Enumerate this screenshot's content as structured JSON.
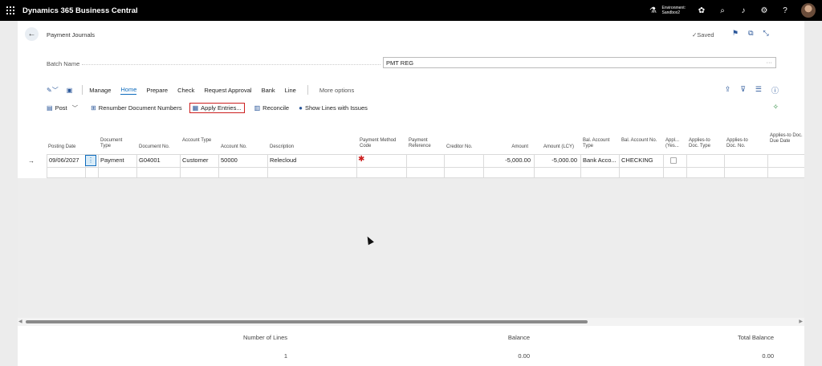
{
  "app": {
    "name": "Dynamics 365 Business Central"
  },
  "environment": {
    "label": "Environment:",
    "name": "Sandbox2"
  },
  "header": {
    "title": "Payment Journals",
    "saved": "✓Saved"
  },
  "batch": {
    "label": "Batch Name",
    "value": "PMT REG",
    "more": "···"
  },
  "actions": {
    "tabs": [
      "Manage",
      "Home",
      "Prepare",
      "Check",
      "Request Approval",
      "Bank",
      "Line"
    ],
    "active_tab": "Home",
    "more_options": "More options"
  },
  "toolbar": {
    "post": "Post",
    "renumber": "Renumber Document Numbers",
    "apply_entries": "Apply Entries...",
    "reconcile": "Reconcile",
    "show_lines": "Show Lines with Issues"
  },
  "columns": {
    "posting_date": "Posting Date",
    "document_type": "Document Type",
    "document_no": "Document No.",
    "account_type": "Account Type",
    "account_no": "Account No.",
    "description": "Description",
    "payment_method_code": "Payment Method Code",
    "payment_reference": "Payment Reference",
    "creditor_no": "Creditor No.",
    "amount": "Amount",
    "amount_lcy": "Amount (LCY)",
    "bal_account_type": "Bal. Account Type",
    "bal_account_no": "Bal. Account No.",
    "applied_yes": "Appl... (Yes...",
    "applies_to_doc_type": "Applies-to Doc. Type",
    "applies_to_doc_no": "Applies-to Doc. No.",
    "applies_to_doc_due_date": "Applies-to Doc. Due Date"
  },
  "rows": [
    {
      "posting_date": "09/06/2027",
      "document_type": "Payment",
      "document_no": "G04001",
      "account_type": "Customer",
      "account_no": "50000",
      "description": "Relecloud",
      "amount": "-5,000.00",
      "amount_lcy": "-5,000.00",
      "bal_account_type": "Bank Acco...",
      "bal_account_no": "CHECKING"
    }
  ],
  "footer": {
    "number_of_lines_label": "Number of Lines",
    "number_of_lines": "1",
    "balance_label": "Balance",
    "balance": "0.00",
    "total_balance_label": "Total Balance",
    "total_balance": "0.00"
  },
  "colors": {
    "topbar": "#000000",
    "accent": "#0f6cbd",
    "highlight": "#cc1f1f",
    "canvas": "#ececec"
  }
}
